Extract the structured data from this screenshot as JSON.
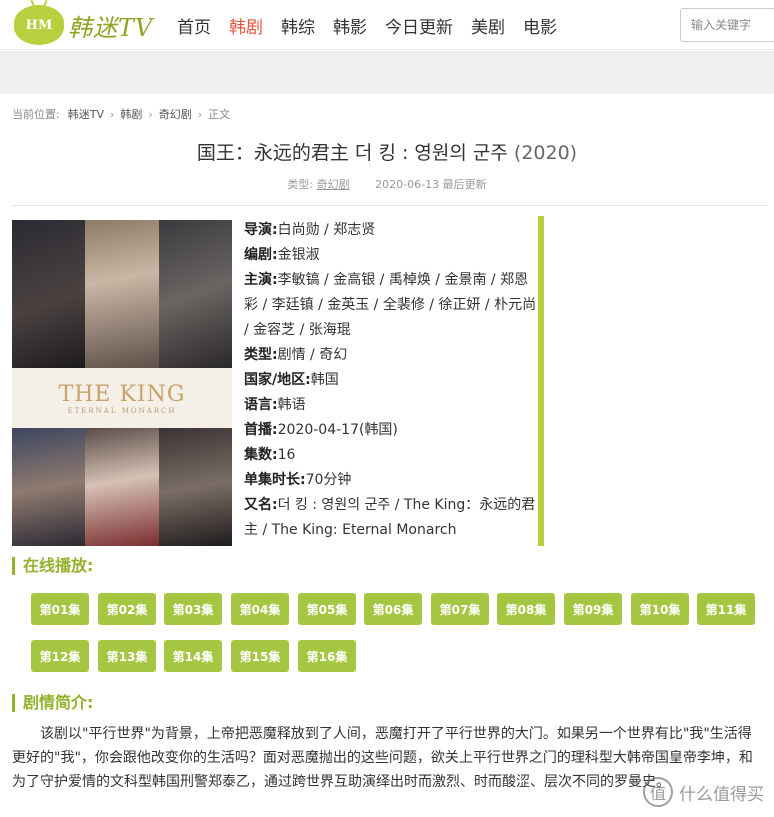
{
  "header": {
    "logo_badge": "HM",
    "logo_text": "韩迷TV",
    "nav": [
      {
        "label": "首页",
        "active": false
      },
      {
        "label": "韩剧",
        "active": true
      },
      {
        "label": "韩综",
        "active": false
      },
      {
        "label": "韩影",
        "active": false
      },
      {
        "label": "今日更新",
        "active": false
      },
      {
        "label": "美剧",
        "active": false
      },
      {
        "label": "电影",
        "active": false
      }
    ],
    "search_placeholder": "输入关键字"
  },
  "breadcrumb": {
    "prefix": "当前位置:",
    "items": [
      "韩迷TV",
      "韩剧",
      "奇幻剧",
      "正文"
    ]
  },
  "article": {
    "title": "国王：永远的君主 더 킹 : 영원의 군주",
    "year": "(2020)",
    "type_label": "类型:",
    "type_value": "奇幻剧",
    "updated": "2020-06-13 最后更新"
  },
  "poster": {
    "title": "THE KING",
    "subtitle": "ETERNAL MONARCH"
  },
  "info": [
    {
      "label": "导演:",
      "value": "白尚勋 / 郑志贤"
    },
    {
      "label": "编剧:",
      "value": "金银淑"
    },
    {
      "label": "主演:",
      "value": "李敏镐 / 金高银 / 禹棹焕 / 金景南 / 郑恩彩 / 李廷镇 / 金英玉 / 全裴修 / 徐正妍 / 朴元尚 / 金容芝 / 张海琨"
    },
    {
      "label": "类型:",
      "value": "剧情 / 奇幻"
    },
    {
      "label": "国家/地区:",
      "value": "韩国"
    },
    {
      "label": "语言:",
      "value": "韩语"
    },
    {
      "label": "首播:",
      "value": "2020-04-17(韩国)"
    },
    {
      "label": "集数:",
      "value": "16"
    },
    {
      "label": "单集时长:",
      "value": "70分钟"
    },
    {
      "label": "又名:",
      "value": "더 킹 : 영원의 군주 / The King：永远的君主 / The King: Eternal Monarch"
    }
  ],
  "online_title": "在线播放:",
  "episodes": [
    "第01集",
    "第02集",
    "第03集",
    "第04集",
    "第05集",
    "第06集",
    "第07集",
    "第08集",
    "第09集",
    "第10集",
    "第11集",
    "第12集",
    "第13集",
    "第14集",
    "第15集",
    "第16集"
  ],
  "plot_title": "剧情简介:",
  "plot": "该剧以\"平行世界\"为背景，上帝把恶魔释放到了人间，恶魔打开了平行世界的大门。如果另一个世界有比\"我\"生活得更好的\"我\"，你会跟他改变你的生活吗？面对恶魔抛出的这些问题，欲关上平行世界之门的理科型大韩帝国皇帝李坤，和为了守护爱情的文科型韩国刑警郑泰乙，通过跨世界互助演绎出时而激烈、时而酸涩、层次不同的罗曼史。",
  "watermark": "什么值得买",
  "colors": {
    "accent": "#a5c640",
    "nav_active": "#e4553f",
    "section": "#93b22d"
  }
}
